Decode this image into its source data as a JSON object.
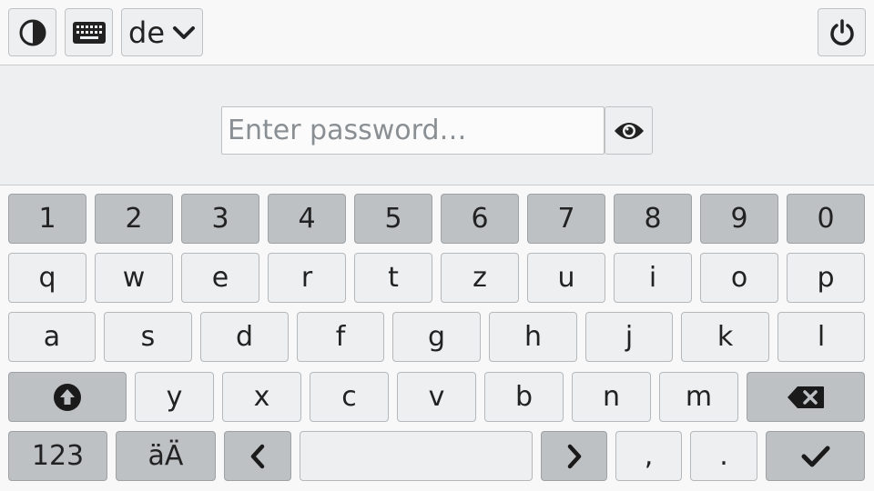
{
  "topbar": {
    "contrast_icon": "contrast-icon",
    "keyboard_icon": "keyboard-icon",
    "language_label": "de",
    "chevron_icon": "chevron-down-icon",
    "power_icon": "power-icon"
  },
  "password": {
    "placeholder": "Enter password…",
    "value": "",
    "eye_icon": "eye-icon"
  },
  "keyboard": {
    "numbers": [
      "1",
      "2",
      "3",
      "4",
      "5",
      "6",
      "7",
      "8",
      "9",
      "0"
    ],
    "row1": [
      "q",
      "w",
      "e",
      "r",
      "t",
      "z",
      "u",
      "i",
      "o",
      "p"
    ],
    "row2": [
      "a",
      "s",
      "d",
      "f",
      "g",
      "h",
      "j",
      "k",
      "l"
    ],
    "row3": [
      "y",
      "x",
      "c",
      "v",
      "b",
      "n",
      "m"
    ],
    "numeric_label": "123",
    "umlaut_label": "äÄ",
    "comma": ",",
    "period": ".",
    "shift_icon": "shift-icon",
    "backspace_icon": "backspace-icon",
    "left_icon": "chevron-left-icon",
    "right_icon": "chevron-right-icon",
    "enter_icon": "checkmark-icon",
    "space_label": ""
  },
  "colors": {
    "key_light": "#eeeff0",
    "key_dark": "#bdc1c4",
    "background": "#f8f8f9"
  }
}
